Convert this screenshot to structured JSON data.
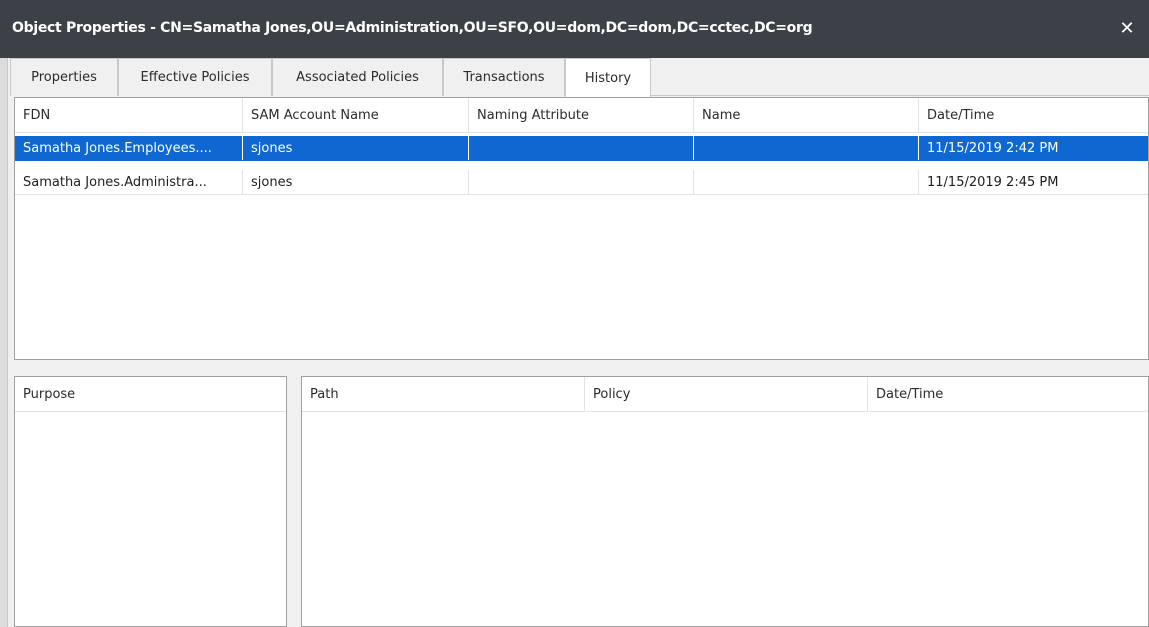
{
  "window": {
    "title": "Object Properties  -  CN=Samatha Jones,OU=Administration,OU=SFO,OU=dom,DC=dom,DC=cctec,DC=org",
    "close_icon": "close-icon"
  },
  "tabs": [
    {
      "label": "Properties"
    },
    {
      "label": "Effective Policies"
    },
    {
      "label": "Associated Policies"
    },
    {
      "label": "Transactions"
    },
    {
      "label": "History",
      "active": true
    }
  ],
  "history_table": {
    "columns": [
      "FDN",
      "SAM Account Name",
      "Naming Attribute",
      "Name",
      "Date/Time"
    ],
    "rows": [
      {
        "fdn": "Samatha Jones.Employees....",
        "sam": "sjones",
        "naming": "",
        "name": "",
        "datetime": "11/15/2019 2:42 PM",
        "selected": true
      },
      {
        "fdn": "Samatha Jones.Administra...",
        "sam": "sjones",
        "naming": "",
        "name": "",
        "datetime": "11/15/2019 2:45 PM",
        "selected": false
      }
    ]
  },
  "purpose_table": {
    "columns": [
      "Purpose"
    ]
  },
  "policy_table": {
    "columns": [
      "Path",
      "Policy",
      "Date/Time"
    ]
  },
  "colors": {
    "titlebar": "#3c4148",
    "selection": "#0f68d2"
  }
}
